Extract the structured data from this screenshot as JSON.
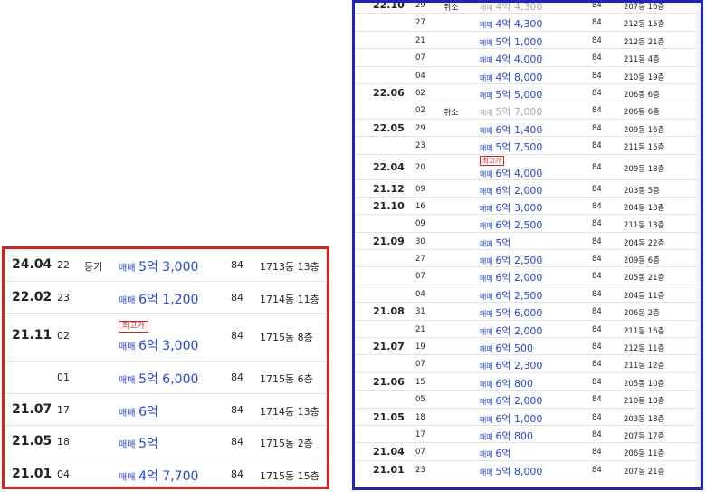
{
  "colors": {
    "left_border": "#e0201c",
    "right_border": "#1c23c9",
    "price": "#2346d6",
    "cancelled_price": "#a9a9a9",
    "badge": "#e0201c"
  },
  "left_panel": {
    "rows": [
      {
        "month": "24.04",
        "day": "22",
        "note": "등기",
        "kind": "매매",
        "price": "5억 3,000",
        "area": "84",
        "unit": "1713동 13층",
        "badge": ""
      },
      {
        "month": "22.02",
        "day": "23",
        "note": "",
        "kind": "매매",
        "price": "6억 1,200",
        "area": "84",
        "unit": "1714동 11층",
        "badge": ""
      },
      {
        "month": "21.11",
        "day": "02",
        "note": "",
        "kind": "매매",
        "price": "6억 3,000",
        "area": "84",
        "unit": "1715동 8층",
        "badge": "최고가"
      },
      {
        "month": "",
        "day": "01",
        "note": "",
        "kind": "매매",
        "price": "5억 6,000",
        "area": "84",
        "unit": "1715동 6층",
        "badge": ""
      },
      {
        "month": "21.07",
        "day": "17",
        "note": "",
        "kind": "매매",
        "price": "6억",
        "area": "84",
        "unit": "1714동 13층",
        "badge": ""
      },
      {
        "month": "21.05",
        "day": "18",
        "note": "",
        "kind": "매매",
        "price": "5억",
        "area": "84",
        "unit": "1715동 2층",
        "badge": ""
      },
      {
        "month": "21.01",
        "day": "04",
        "note": "",
        "kind": "매매",
        "price": "4억 7,700",
        "area": "84",
        "unit": "1715동 15층",
        "badge": ""
      }
    ]
  },
  "right_panel": {
    "rows": [
      {
        "month": "22.10",
        "day": "29",
        "note": "취소",
        "kind": "매매",
        "price": "4억 4,300",
        "area": "84",
        "unit": "207동 16층",
        "badge": "",
        "cancelled": true
      },
      {
        "month": "",
        "day": "27",
        "note": "",
        "kind": "매매",
        "price": "4억 4,300",
        "area": "84",
        "unit": "212동 15층",
        "badge": ""
      },
      {
        "month": "",
        "day": "21",
        "note": "",
        "kind": "매매",
        "price": "5억 1,000",
        "area": "84",
        "unit": "212동 21층",
        "badge": ""
      },
      {
        "month": "",
        "day": "07",
        "note": "",
        "kind": "매매",
        "price": "4억 4,000",
        "area": "84",
        "unit": "211동 4층",
        "badge": ""
      },
      {
        "month": "",
        "day": "04",
        "note": "",
        "kind": "매매",
        "price": "4억 8,000",
        "area": "84",
        "unit": "210동 19층",
        "badge": ""
      },
      {
        "month": "22.06",
        "day": "02",
        "note": "",
        "kind": "매매",
        "price": "5억 5,000",
        "area": "84",
        "unit": "206동 6층",
        "badge": ""
      },
      {
        "month": "",
        "day": "02",
        "note": "취소",
        "kind": "매매",
        "price": "5억 7,000",
        "area": "84",
        "unit": "206동 6층",
        "badge": "",
        "cancelled": true
      },
      {
        "month": "22.05",
        "day": "29",
        "note": "",
        "kind": "매매",
        "price": "6억 1,400",
        "area": "84",
        "unit": "209동 16층",
        "badge": ""
      },
      {
        "month": "",
        "day": "23",
        "note": "",
        "kind": "매매",
        "price": "5억 7,500",
        "area": "84",
        "unit": "211동 15층",
        "badge": ""
      },
      {
        "month": "22.04",
        "day": "20",
        "note": "",
        "kind": "매매",
        "price": "6억 4,000",
        "area": "84",
        "unit": "209동 18층",
        "badge": "최고가"
      },
      {
        "month": "21.12",
        "day": "09",
        "note": "",
        "kind": "매매",
        "price": "6억 2,000",
        "area": "84",
        "unit": "203동 5층",
        "badge": ""
      },
      {
        "month": "21.10",
        "day": "16",
        "note": "",
        "kind": "매매",
        "price": "6억 3,000",
        "area": "84",
        "unit": "204동 18층",
        "badge": ""
      },
      {
        "month": "",
        "day": "09",
        "note": "",
        "kind": "매매",
        "price": "6억 2,500",
        "area": "84",
        "unit": "211동 13층",
        "badge": ""
      },
      {
        "month": "21.09",
        "day": "30",
        "note": "",
        "kind": "매매",
        "price": "5억",
        "area": "84",
        "unit": "204동 22층",
        "badge": ""
      },
      {
        "month": "",
        "day": "27",
        "note": "",
        "kind": "매매",
        "price": "6억 2,500",
        "area": "84",
        "unit": "209동 6층",
        "badge": ""
      },
      {
        "month": "",
        "day": "07",
        "note": "",
        "kind": "매매",
        "price": "6억 2,000",
        "area": "84",
        "unit": "205동 21층",
        "badge": ""
      },
      {
        "month": "",
        "day": "04",
        "note": "",
        "kind": "매매",
        "price": "6억 2,500",
        "area": "84",
        "unit": "204동 11층",
        "badge": ""
      },
      {
        "month": "21.08",
        "day": "31",
        "note": "",
        "kind": "매매",
        "price": "5억 6,000",
        "area": "84",
        "unit": "206동 2층",
        "badge": ""
      },
      {
        "month": "",
        "day": "21",
        "note": "",
        "kind": "매매",
        "price": "6억 2,000",
        "area": "84",
        "unit": "211동 16층",
        "badge": ""
      },
      {
        "month": "21.07",
        "day": "19",
        "note": "",
        "kind": "매매",
        "price": "6억 500",
        "area": "84",
        "unit": "212동 11층",
        "badge": ""
      },
      {
        "month": "",
        "day": "07",
        "note": "",
        "kind": "매매",
        "price": "6억 2,300",
        "area": "84",
        "unit": "211동 12층",
        "badge": ""
      },
      {
        "month": "21.06",
        "day": "15",
        "note": "",
        "kind": "매매",
        "price": "6억 800",
        "area": "84",
        "unit": "205동 10층",
        "badge": ""
      },
      {
        "month": "",
        "day": "05",
        "note": "",
        "kind": "매매",
        "price": "6억 2,000",
        "area": "84",
        "unit": "210동 18층",
        "badge": ""
      },
      {
        "month": "21.05",
        "day": "18",
        "note": "",
        "kind": "매매",
        "price": "6억 1,000",
        "area": "84",
        "unit": "203동 18층",
        "badge": ""
      },
      {
        "month": "",
        "day": "17",
        "note": "",
        "kind": "매매",
        "price": "6억 800",
        "area": "84",
        "unit": "207동 17층",
        "badge": ""
      },
      {
        "month": "21.04",
        "day": "07",
        "note": "",
        "kind": "매매",
        "price": "6억",
        "area": "84",
        "unit": "206동 11층",
        "badge": ""
      },
      {
        "month": "21.01",
        "day": "23",
        "note": "",
        "kind": "매매",
        "price": "5억 8,000",
        "area": "84",
        "unit": "207동 21층",
        "badge": ""
      }
    ]
  }
}
